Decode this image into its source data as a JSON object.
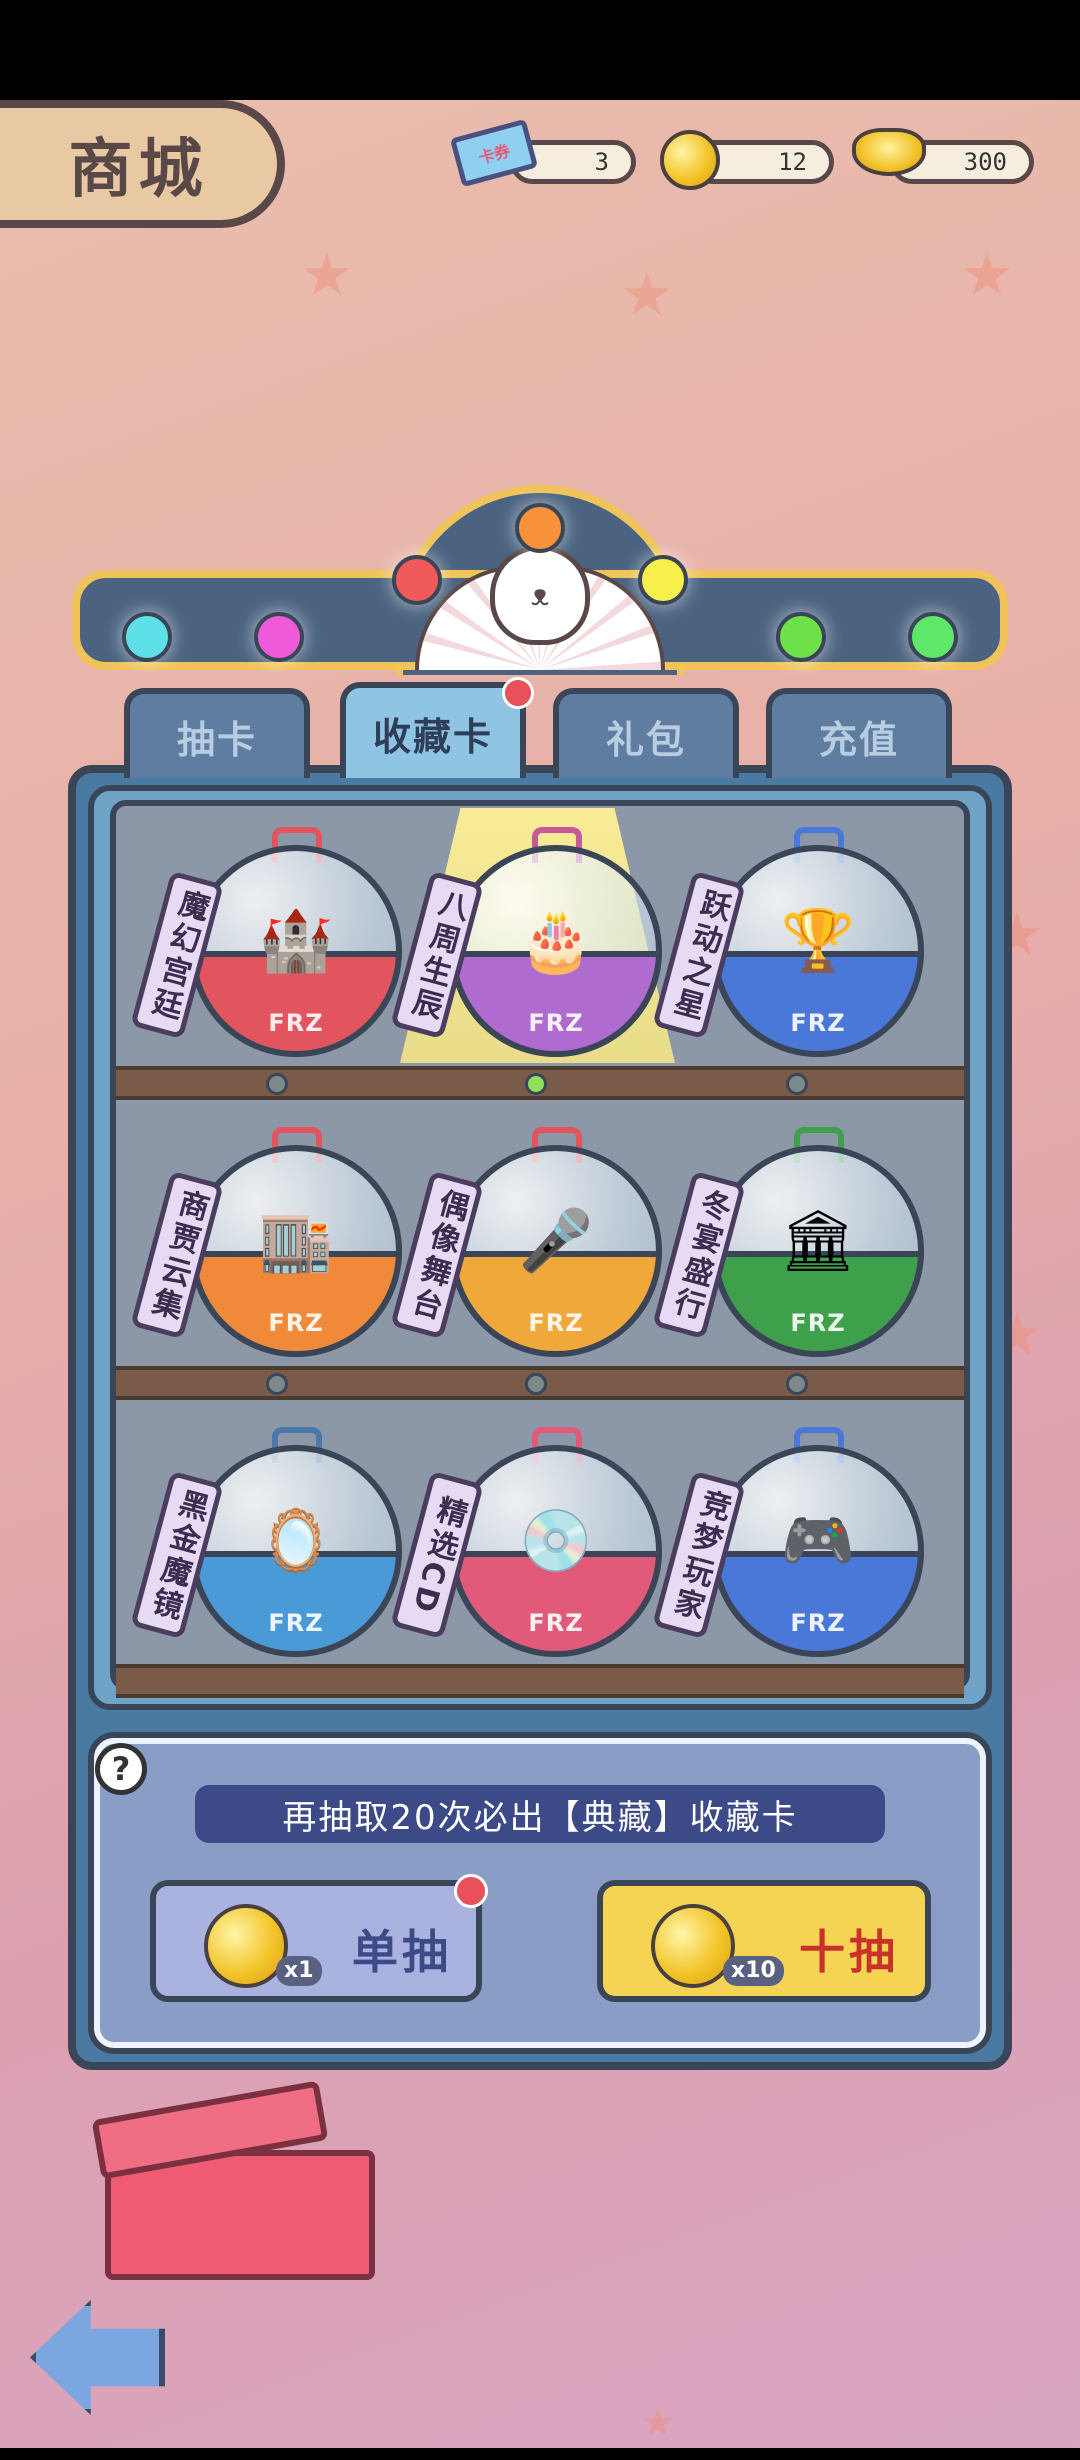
{
  "header": {
    "title": "商城"
  },
  "currencies": {
    "ticket": {
      "icon": "ticket-icon",
      "badge": "卡券",
      "value": "3"
    },
    "coin": {
      "icon": "gold-coin-icon",
      "value": "12"
    },
    "ingot": {
      "icon": "gold-ingot-icon",
      "value": "300"
    }
  },
  "tabs": [
    {
      "label": "抽卡",
      "active": false
    },
    {
      "label": "收藏卡",
      "active": true,
      "has_notification": true
    },
    {
      "label": "礼包",
      "active": false
    },
    {
      "label": "充值",
      "active": false
    }
  ],
  "capsules": [
    {
      "label": "魔幻宫廷",
      "brand": "FRZ",
      "color": "#e2545e",
      "hook": "#e2545e",
      "icon": "castle-icon",
      "glyph": "🏰",
      "selected": false
    },
    {
      "label": "八周生辰",
      "brand": "FRZ",
      "color": "#b06bd0",
      "hook": "#c45a9a",
      "icon": "birthday-cake-icon",
      "glyph": "🎂",
      "selected": true
    },
    {
      "label": "跃动之星",
      "brand": "FRZ",
      "color": "#4a78d8",
      "hook": "#4a78d8",
      "icon": "trophy-icon",
      "glyph": "🏆",
      "selected": false
    },
    {
      "label": "商贾云集",
      "brand": "FRZ",
      "color": "#f08a3a",
      "hook": "#e2545e",
      "icon": "shopping-street-icon",
      "glyph": "🏬",
      "selected": false
    },
    {
      "label": "偶像舞台",
      "brand": "FRZ",
      "color": "#f0a83a",
      "hook": "#e2545e",
      "icon": "stage-speaker-icon",
      "glyph": "🎤",
      "selected": false
    },
    {
      "label": "冬宴盛行",
      "brand": "FRZ",
      "color": "#3ea04a",
      "hook": "#3ea04a",
      "icon": "banquet-hall-icon",
      "glyph": "🏛",
      "selected": false
    },
    {
      "label": "黑金魔镜",
      "brand": "FRZ",
      "color": "#4a9ad8",
      "hook": "#4a78a8",
      "icon": "magic-mirror-icon",
      "glyph": "🪞",
      "selected": false
    },
    {
      "label": "精选CD",
      "brand": "FRZ",
      "color": "#e25a7a",
      "hook": "#e25a7a",
      "icon": "cd-album-icon",
      "glyph": "💿",
      "selected": false
    },
    {
      "label": "竞梦玩家",
      "brand": "FRZ",
      "color": "#4a78d8",
      "hook": "#4a78d8",
      "icon": "game-controller-icon",
      "glyph": "🎮",
      "selected": false
    }
  ],
  "bottom": {
    "guarantee_text": "再抽取20次必出【典藏】收藏卡",
    "single": {
      "label": "单抽",
      "multiplier": "x1",
      "has_notification": true
    },
    "ten": {
      "label": "十抽",
      "multiplier": "x10"
    }
  },
  "colors": {
    "accent_gold": "#f0c45a",
    "machine_blue": "#4a7aa2",
    "notification_red": "#e8505a"
  }
}
